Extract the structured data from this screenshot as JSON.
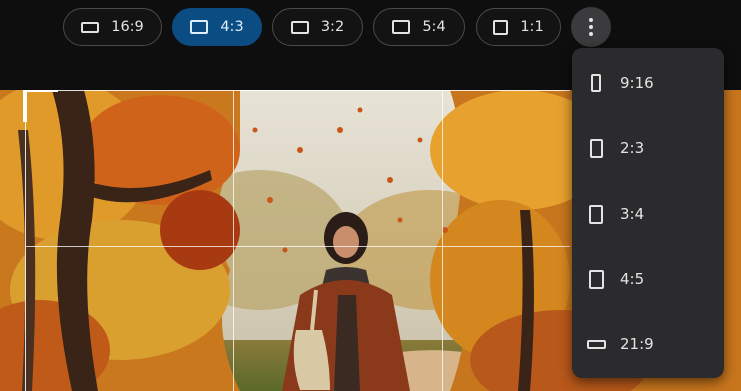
{
  "toolbar": {
    "ratios": [
      {
        "label": "16:9",
        "icon": "landscape-16-9-icon",
        "selected": false
      },
      {
        "label": "4:3",
        "icon": "landscape-4-3-icon",
        "selected": true
      },
      {
        "label": "3:2",
        "icon": "landscape-3-2-icon",
        "selected": false
      },
      {
        "label": "5:4",
        "icon": "landscape-5-4-icon",
        "selected": false
      },
      {
        "label": "1:1",
        "icon": "square-icon",
        "selected": false
      }
    ],
    "more_icon": "more-vert-icon",
    "active_color": "#0b4c83"
  },
  "menu": {
    "items": [
      {
        "label": "9:16",
        "icon": "portrait-9-16-icon"
      },
      {
        "label": "2:3",
        "icon": "portrait-2-3-icon"
      },
      {
        "label": "3:4",
        "icon": "portrait-3-4-icon"
      },
      {
        "label": "4:5",
        "icon": "portrait-4-5-icon"
      },
      {
        "label": "21:9",
        "icon": "ultrawide-21-9-icon"
      }
    ]
  },
  "image": {
    "subject": "Painting of a woman walking on an autumn forest path"
  }
}
